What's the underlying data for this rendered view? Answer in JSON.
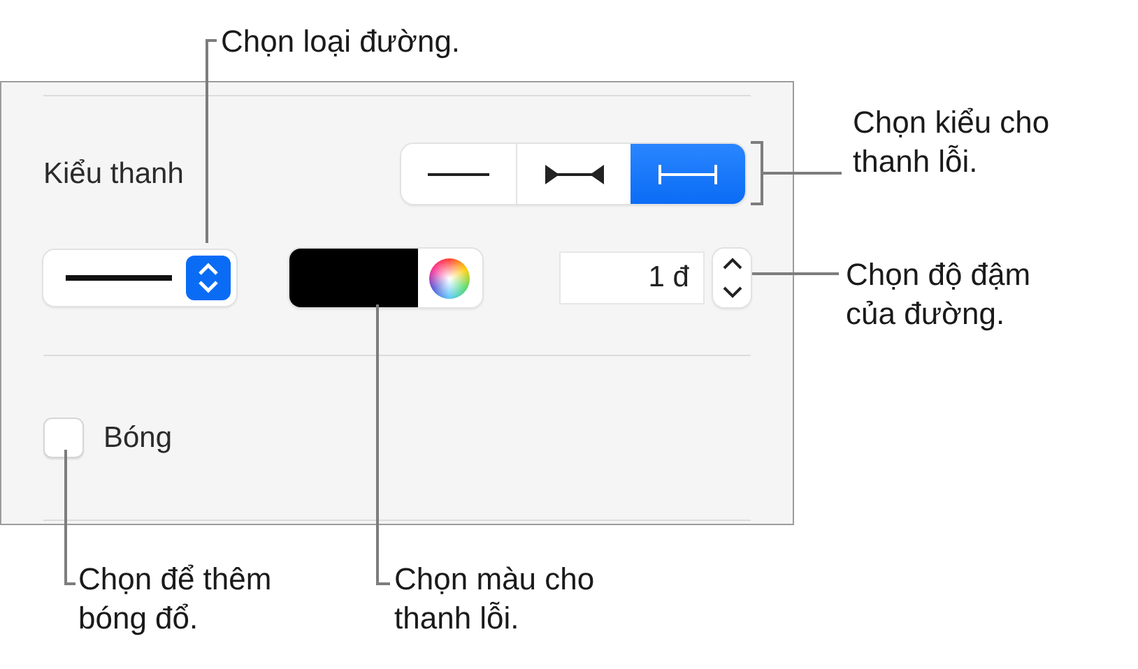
{
  "panel": {
    "bar_style": {
      "label": "Kiểu thanh",
      "options": [
        {
          "kind": "plain",
          "selected": false
        },
        {
          "kind": "arrows",
          "selected": false
        },
        {
          "kind": "caps",
          "selected": true
        }
      ]
    },
    "stroke_color": {
      "color": "#000000"
    },
    "stroke_width": {
      "value": "1 đ"
    },
    "shadow": {
      "label": "Bóng",
      "checked": false
    }
  },
  "callouts": [
    {
      "text": "Chọn loại đường."
    },
    {
      "text": "Chọn kiểu cho thanh lỗi."
    },
    {
      "text": "Chọn độ đậm của đường."
    },
    {
      "text": "Chọn để thêm bóng đổ."
    },
    {
      "text": "Chọn màu cho thanh lỗi."
    }
  ]
}
